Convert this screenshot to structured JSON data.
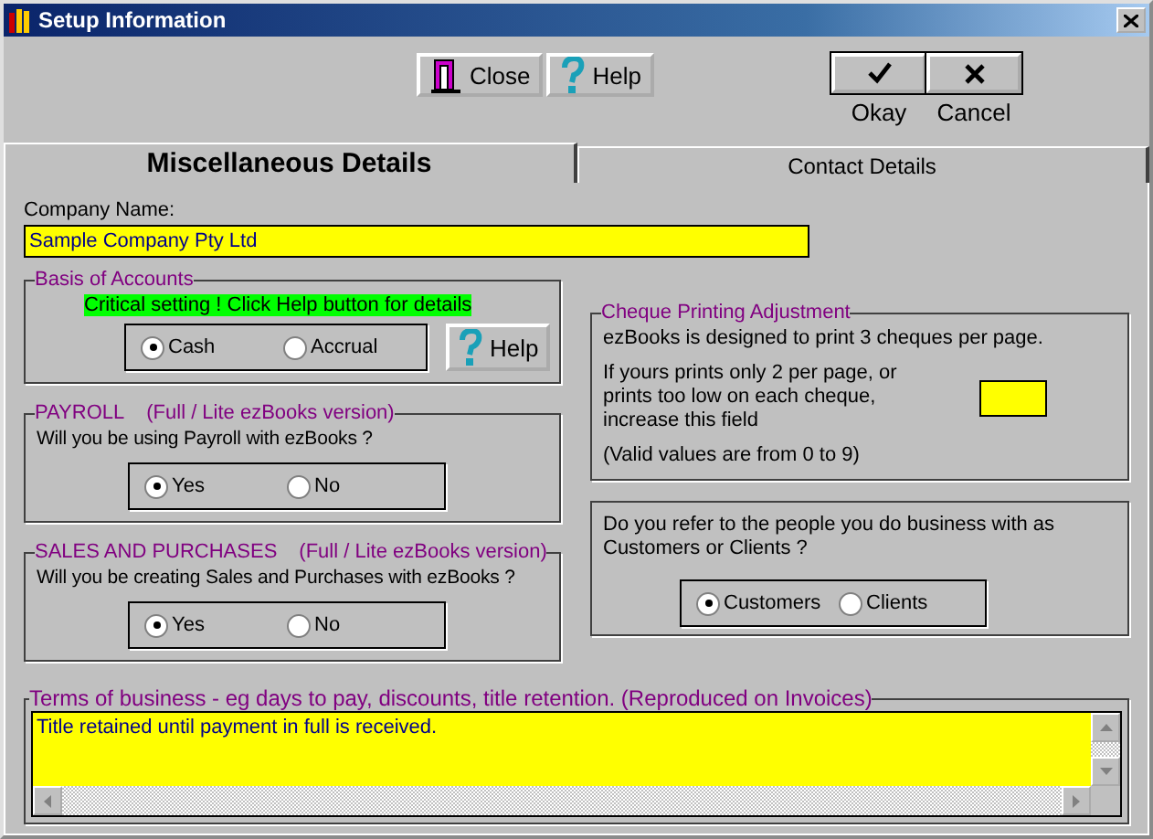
{
  "window": {
    "title": "Setup Information"
  },
  "toolbar": [
    {
      "label": "Close",
      "kind": "close"
    },
    {
      "label": "Help",
      "kind": "help"
    }
  ],
  "dialog_buttons": [
    {
      "label": "Okay",
      "kind": "ok"
    },
    {
      "label": "Cancel",
      "kind": "cancel"
    }
  ],
  "tabs": [
    {
      "label": "Miscellaneous Details",
      "selected": true
    },
    {
      "label": "Contact Details",
      "selected": false
    }
  ],
  "company": {
    "label": "Company Name:",
    "value": "Sample Company Pty Ltd"
  },
  "basis": {
    "legend": "Basis of Accounts",
    "notice": "Critical setting ! Click Help button for details",
    "help_button": "Help",
    "options": [
      {
        "label": "Cash",
        "selected": true
      },
      {
        "label": "Accrual",
        "selected": false
      }
    ]
  },
  "payroll": {
    "legend": "PAYROLL",
    "note": "(Full / Lite ezBooks version)",
    "question": "Will you be using Payroll with ezBooks ?",
    "options": [
      {
        "label": "Yes",
        "selected": true
      },
      {
        "label": "No",
        "selected": false
      }
    ]
  },
  "sales": {
    "legend": "SALES AND PURCHASES",
    "note": "(Full / Lite ezBooks version)",
    "question": "Will you be creating Sales and Purchases with ezBooks ?",
    "options": [
      {
        "label": "Yes",
        "selected": true
      },
      {
        "label": "No",
        "selected": false
      }
    ]
  },
  "cheque": {
    "legend": "Cheque Printing Adjustment",
    "intro": "ezBooks is designed to print 3 cheques per page.",
    "hint_lines": [
      "If yours prints only 2 per page, or",
      "prints too low on each cheque,",
      "increase this field"
    ],
    "range_note": "(Valid values are from 0 to 9)"
  },
  "party": {
    "question_lines": [
      "Do you refer to the people you do business with as",
      "Customers or Clients ?"
    ],
    "options": [
      {
        "label": "Customers",
        "selected": true
      },
      {
        "label": "Clients",
        "selected": false
      }
    ]
  },
  "terms": {
    "legend": "Terms of business - eg days to pay, discounts, title retention. (Reproduced on Invoices)",
    "value": "Title retained until payment in full is received."
  }
}
